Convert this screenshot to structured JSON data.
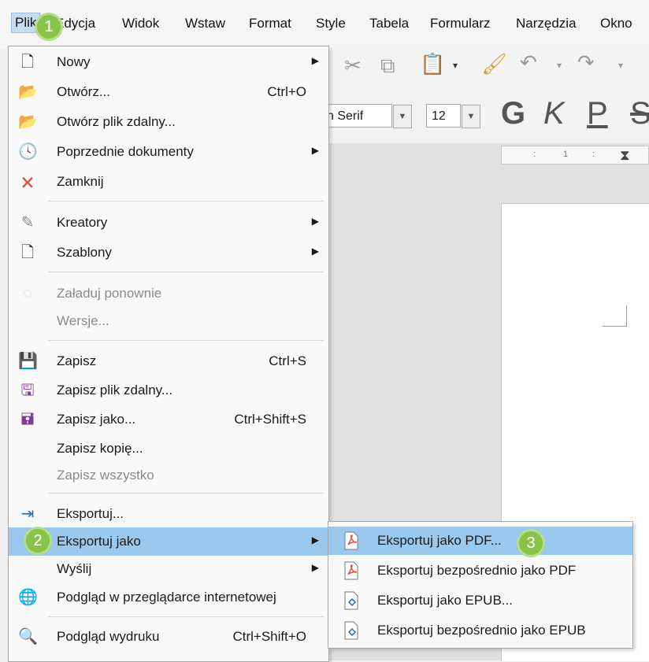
{
  "menubar": {
    "items": [
      "Plik",
      "Edycja",
      "Widok",
      "Wstaw",
      "Format",
      "Style",
      "Tabela",
      "Formularz",
      "Narzędzia",
      "Okno"
    ]
  },
  "toolbar": {
    "font_name": "n Serif",
    "font_size": "12",
    "format_buttons": [
      "G",
      "K",
      "P",
      "S"
    ],
    "ruler_marks": [
      ":",
      "1",
      ":"
    ]
  },
  "menu": {
    "items": [
      {
        "label": "Nowy",
        "shortcut": "",
        "submenu": true,
        "icon": "new-document-icon",
        "disabled": false
      },
      {
        "label": "Otwórz...",
        "shortcut": "Ctrl+O",
        "submenu": false,
        "icon": "open-folder-icon",
        "disabled": false
      },
      {
        "label": "Otwórz plik zdalny...",
        "shortcut": "",
        "submenu": false,
        "icon": "open-remote-icon",
        "disabled": false
      },
      {
        "label": "Poprzednie dokumenty",
        "shortcut": "",
        "submenu": true,
        "icon": "clock-icon",
        "disabled": false
      },
      {
        "label": "Zamknij",
        "shortcut": "",
        "submenu": false,
        "icon": "close-document-icon",
        "disabled": false
      },
      {
        "label": "Kreatory",
        "shortcut": "",
        "submenu": true,
        "icon": "wizard-wand-icon",
        "disabled": false
      },
      {
        "label": "Szablony",
        "shortcut": "",
        "submenu": true,
        "icon": "template-icon",
        "disabled": false
      },
      {
        "label": "Załaduj ponownie",
        "shortcut": "",
        "submenu": false,
        "icon": "reload-icon",
        "disabled": true
      },
      {
        "label": "Wersje...",
        "shortcut": "",
        "submenu": false,
        "icon": "",
        "disabled": true
      },
      {
        "label": "Zapisz",
        "shortcut": "Ctrl+S",
        "submenu": false,
        "icon": "save-icon",
        "disabled": false
      },
      {
        "label": "Zapisz plik zdalny...",
        "shortcut": "",
        "submenu": false,
        "icon": "save-remote-icon",
        "disabled": false
      },
      {
        "label": "Zapisz jako...",
        "shortcut": "Ctrl+Shift+S",
        "submenu": false,
        "icon": "save-as-icon",
        "disabled": false
      },
      {
        "label": "Zapisz kopię...",
        "shortcut": "",
        "submenu": false,
        "icon": "",
        "disabled": false
      },
      {
        "label": "Zapisz wszystko",
        "shortcut": "",
        "submenu": false,
        "icon": "",
        "disabled": true
      },
      {
        "label": "Eksportuj...",
        "shortcut": "",
        "submenu": false,
        "icon": "export-icon",
        "disabled": false
      },
      {
        "label": "Eksportuj jako",
        "shortcut": "",
        "submenu": true,
        "icon": "",
        "disabled": false
      },
      {
        "label": "Wyślij",
        "shortcut": "",
        "submenu": true,
        "icon": "",
        "disabled": false
      },
      {
        "label": "Podgląd w przeglądarce internetowej",
        "shortcut": "",
        "submenu": false,
        "icon": "globe-icon",
        "disabled": false
      },
      {
        "label": "Podgląd wydruku",
        "shortcut": "Ctrl+Shift+O",
        "submenu": false,
        "icon": "print-preview-icon",
        "disabled": false
      }
    ]
  },
  "submenu": {
    "items": [
      {
        "label": "Eksportuj jako PDF...",
        "icon": "pdf-icon"
      },
      {
        "label": "Eksportuj bezpośrednio jako PDF",
        "icon": "pdf-direct-icon"
      },
      {
        "label": "Eksportuj jako EPUB...",
        "icon": "epub-icon"
      },
      {
        "label": "Eksportuj bezpośrednio jako EPUB",
        "icon": "epub-direct-icon"
      }
    ]
  },
  "badges": [
    "1",
    "2",
    "3"
  ],
  "colors": {
    "highlight": "#99c9ef",
    "badge": "#8bc34a",
    "save_icon": "#7d3c98"
  }
}
